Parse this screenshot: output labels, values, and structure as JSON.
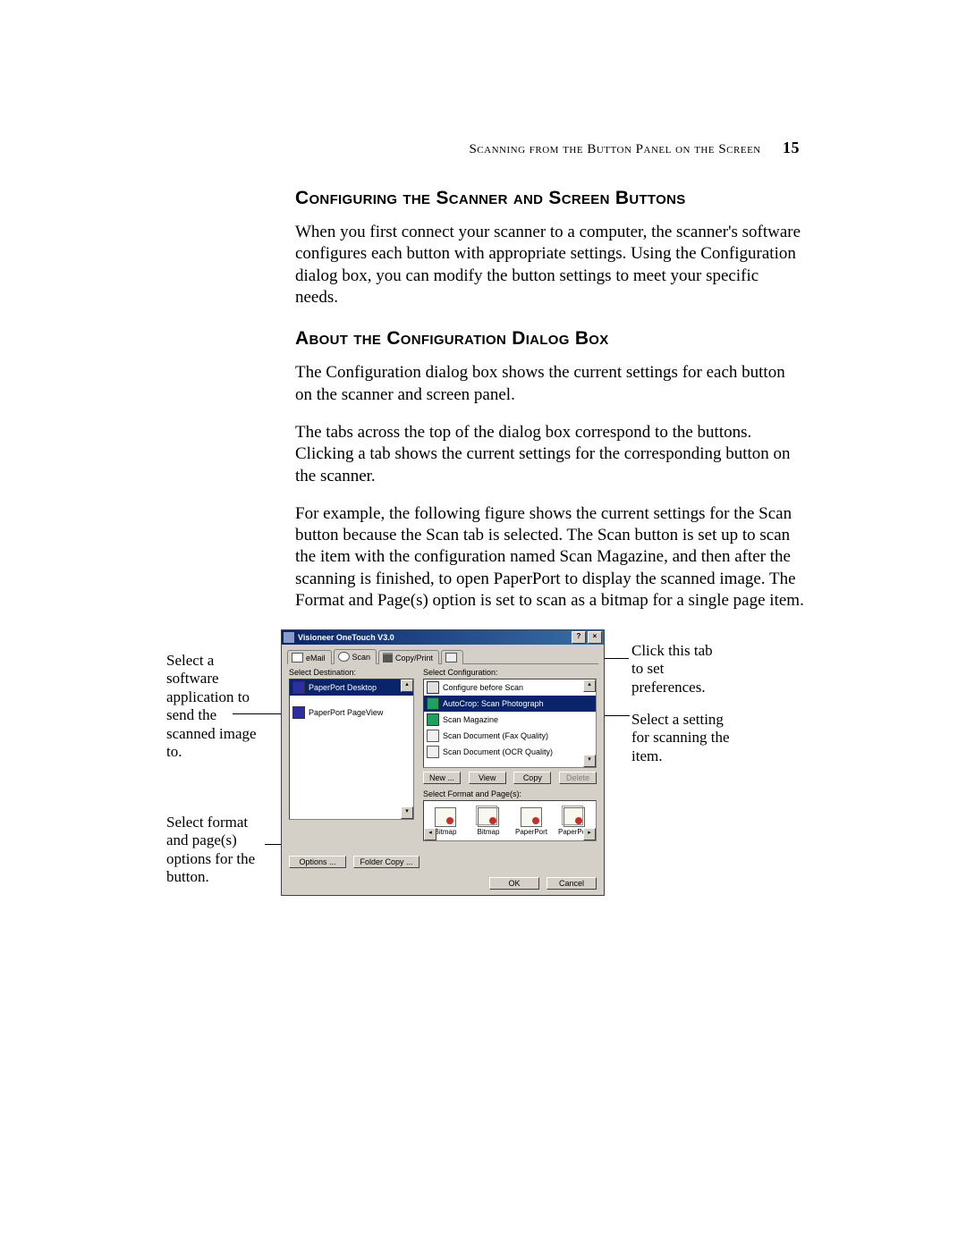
{
  "header": {
    "running_head": "Scanning from the Button Panel on the Screen",
    "page_number": "15"
  },
  "sections": {
    "h1": "Configuring the Scanner and Screen Buttons",
    "p1": "When you first connect your scanner to a computer, the scanner's software configures each button with appropriate settings. Using the Configuration dialog box, you can modify the button settings to meet your specific needs.",
    "h2": "About the Configuration Dialog Box",
    "p2": "The Configuration dialog box shows the current settings for each button on the scanner and screen panel.",
    "p3": "The tabs across the top of the dialog box correspond to the buttons. Clicking a tab shows the current settings for the corresponding button on the scanner.",
    "p4": "For example, the following figure shows the current settings for the Scan button because the Scan tab is selected. The Scan button is set up to scan the item with the configuration named Scan Magazine, and then after the scanning is finished, to open PaperPort to display the scanned image. The Format and Page(s) option is set to scan as a bitmap for a single page item."
  },
  "callouts": {
    "left_top": "Select a software application to send the scanned image to.",
    "left_bottom": "Select format and page(s) options for the button.",
    "right_top": "Click this tab to set preferences.",
    "right_bottom": "Select a setting for scanning the item."
  },
  "dialog": {
    "title": "Visioneer OneTouch V3.0",
    "help_btn": "?",
    "close_btn": "×",
    "tabs": {
      "email": "eMail",
      "scan": "Scan",
      "copyprint": "Copy/Print",
      "pref": ""
    },
    "left_label": "Select Destination:",
    "right_label": "Select Configuration:",
    "destinations": [
      "PaperPort Desktop",
      "PaperPort PageView"
    ],
    "configs": [
      "Configure before Scan",
      "AutoCrop: Scan Photograph",
      "Scan Magazine",
      "Scan Document (Fax Quality)",
      "Scan Document (OCR Quality)"
    ],
    "cfg_buttons": {
      "new": "New ...",
      "view": "View",
      "copy": "Copy",
      "delete": "Delete"
    },
    "fmt_label": "Select Format and Page(s):",
    "fmt_items": [
      "Bitmap",
      "Bitmap",
      "PaperPort",
      "PaperPort"
    ],
    "left_buttons": {
      "options": "Options ...",
      "folder": "Folder Copy ..."
    },
    "footer": {
      "ok": "OK",
      "cancel": "Cancel"
    }
  }
}
